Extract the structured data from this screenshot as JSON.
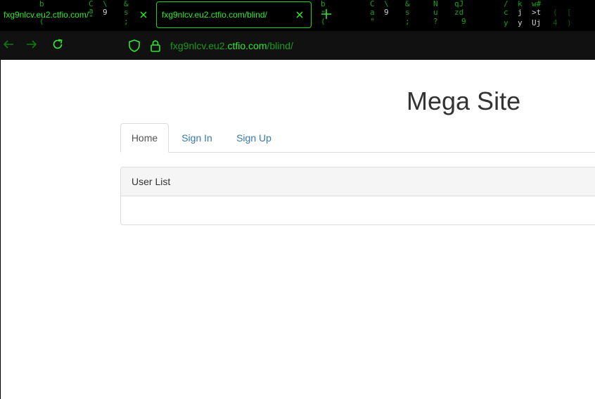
{
  "browser": {
    "tabs": [
      {
        "title": "fxg9nlcv.eu2.ctfio.com/",
        "active": false
      },
      {
        "title": "fxg9nlcv.eu2.ctfio.com/blind/",
        "active": true
      }
    ],
    "address": {
      "prefix": "fxg9nlcv.eu2.",
      "host": "ctfio.com",
      "path": "/blind/"
    },
    "theme": {
      "accent": "#2ee82e",
      "dim_accent": "#1a9a1a",
      "tabstrip_bg": "#000000",
      "toolbar_bg": "#111111"
    }
  },
  "page": {
    "site_title": "Mega Site",
    "tabs": [
      "Home",
      "Sign In",
      "Sign Up"
    ],
    "active_tab": "Home",
    "panel": {
      "heading": "User List",
      "body": ""
    },
    "colors": {
      "link": "#337ab7",
      "title": "#333333",
      "panel_heading_bg": "#f5f5f5",
      "border": "#dddddd"
    }
  }
}
